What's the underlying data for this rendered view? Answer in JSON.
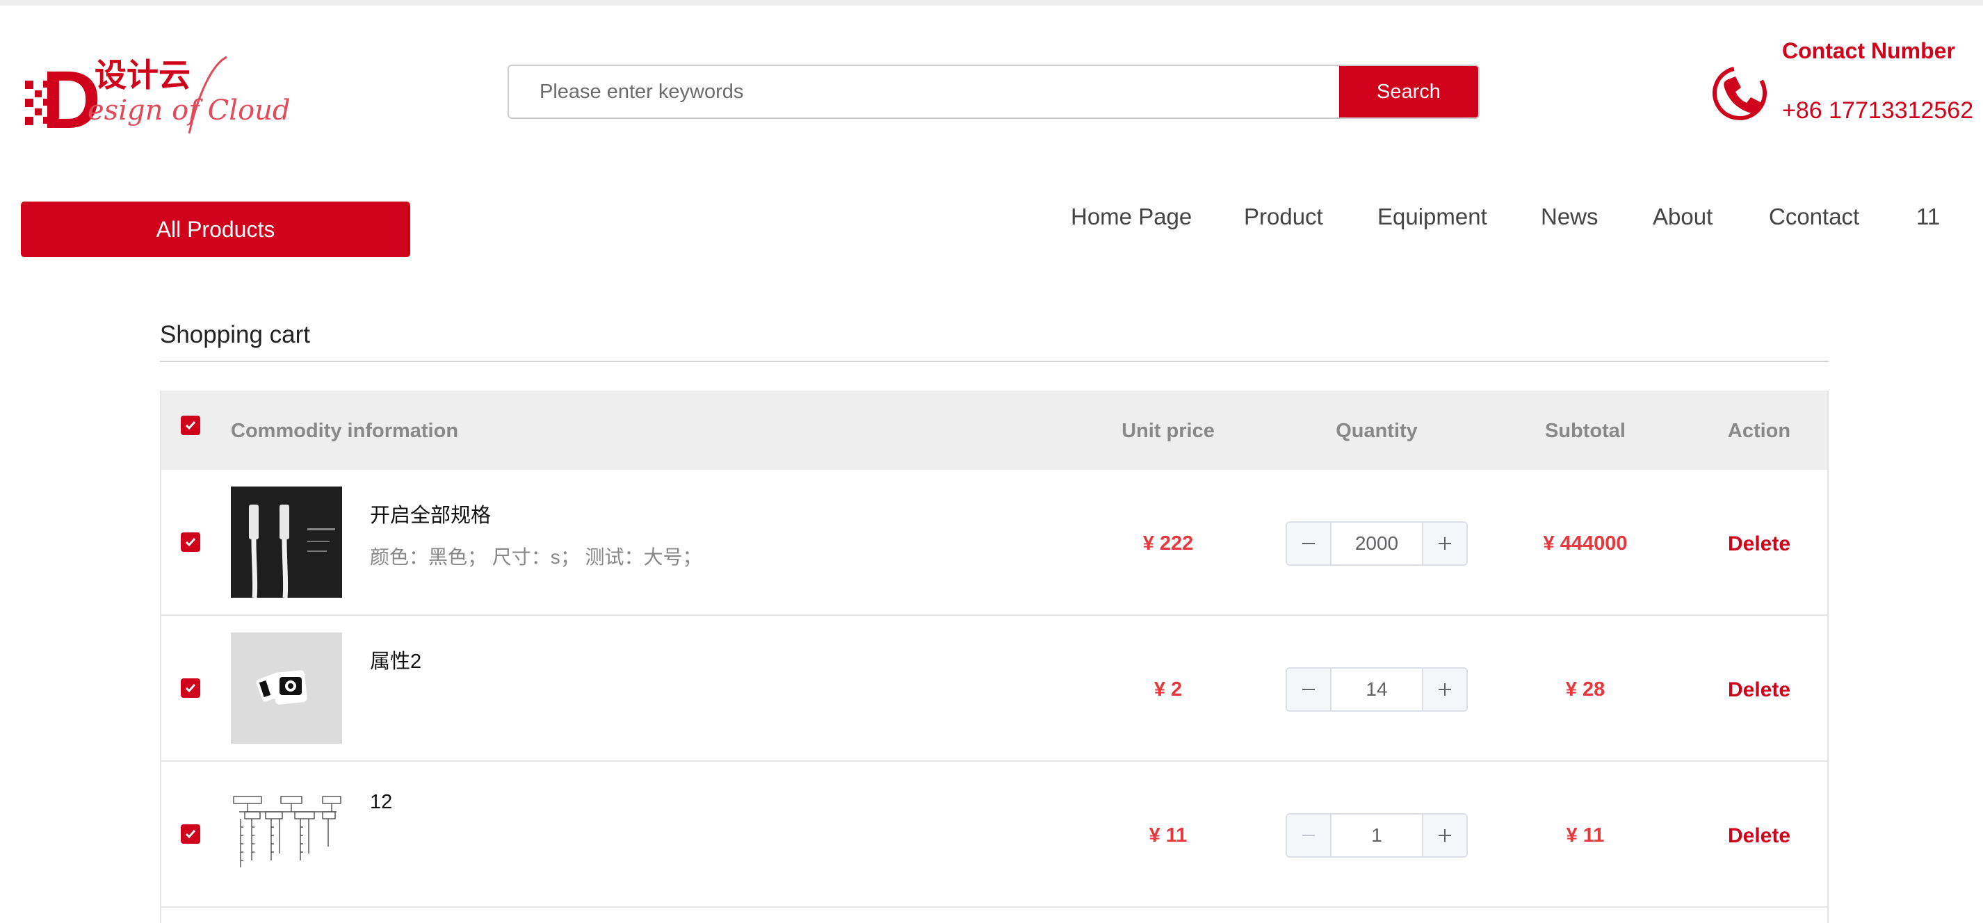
{
  "brand": {
    "logo_cn": "设计云",
    "logo_en": "esign of Cloud",
    "logo_initial": "D",
    "accent_color": "#d0021b"
  },
  "search": {
    "placeholder": "Please enter keywords",
    "value": "",
    "button_label": "Search"
  },
  "contact": {
    "label": "Contact Number",
    "number": "+86 17713312562",
    "icon": "phone-icon"
  },
  "nav": {
    "all_products_label": "All Products",
    "items": [
      "Home Page",
      "Product",
      "Equipment",
      "News",
      "About",
      "Ccontact",
      "11"
    ]
  },
  "cart": {
    "title": "Shopping cart",
    "columns": {
      "info": "Commodity information",
      "unit_price": "Unit price",
      "quantity": "Quantity",
      "subtotal": "Subtotal",
      "action": "Action"
    },
    "select_all_checked": true,
    "items": [
      {
        "name": "开启全部规格",
        "spec": "颜色：黑色；  尺寸：s；  测试：大号；",
        "unit_price": "¥ 222",
        "quantity": "2000",
        "subtotal": "¥ 444000",
        "action": "Delete",
        "checked": true,
        "minus_disabled": false
      },
      {
        "name": "属性2",
        "spec": "",
        "unit_price": "¥ 2",
        "quantity": "14",
        "subtotal": "¥ 28",
        "action": "Delete",
        "checked": true,
        "minus_disabled": false
      },
      {
        "name": "12",
        "spec": "",
        "unit_price": "¥ 11",
        "quantity": "1",
        "subtotal": "¥ 11",
        "action": "Delete",
        "checked": true,
        "minus_disabled": true
      }
    ]
  }
}
